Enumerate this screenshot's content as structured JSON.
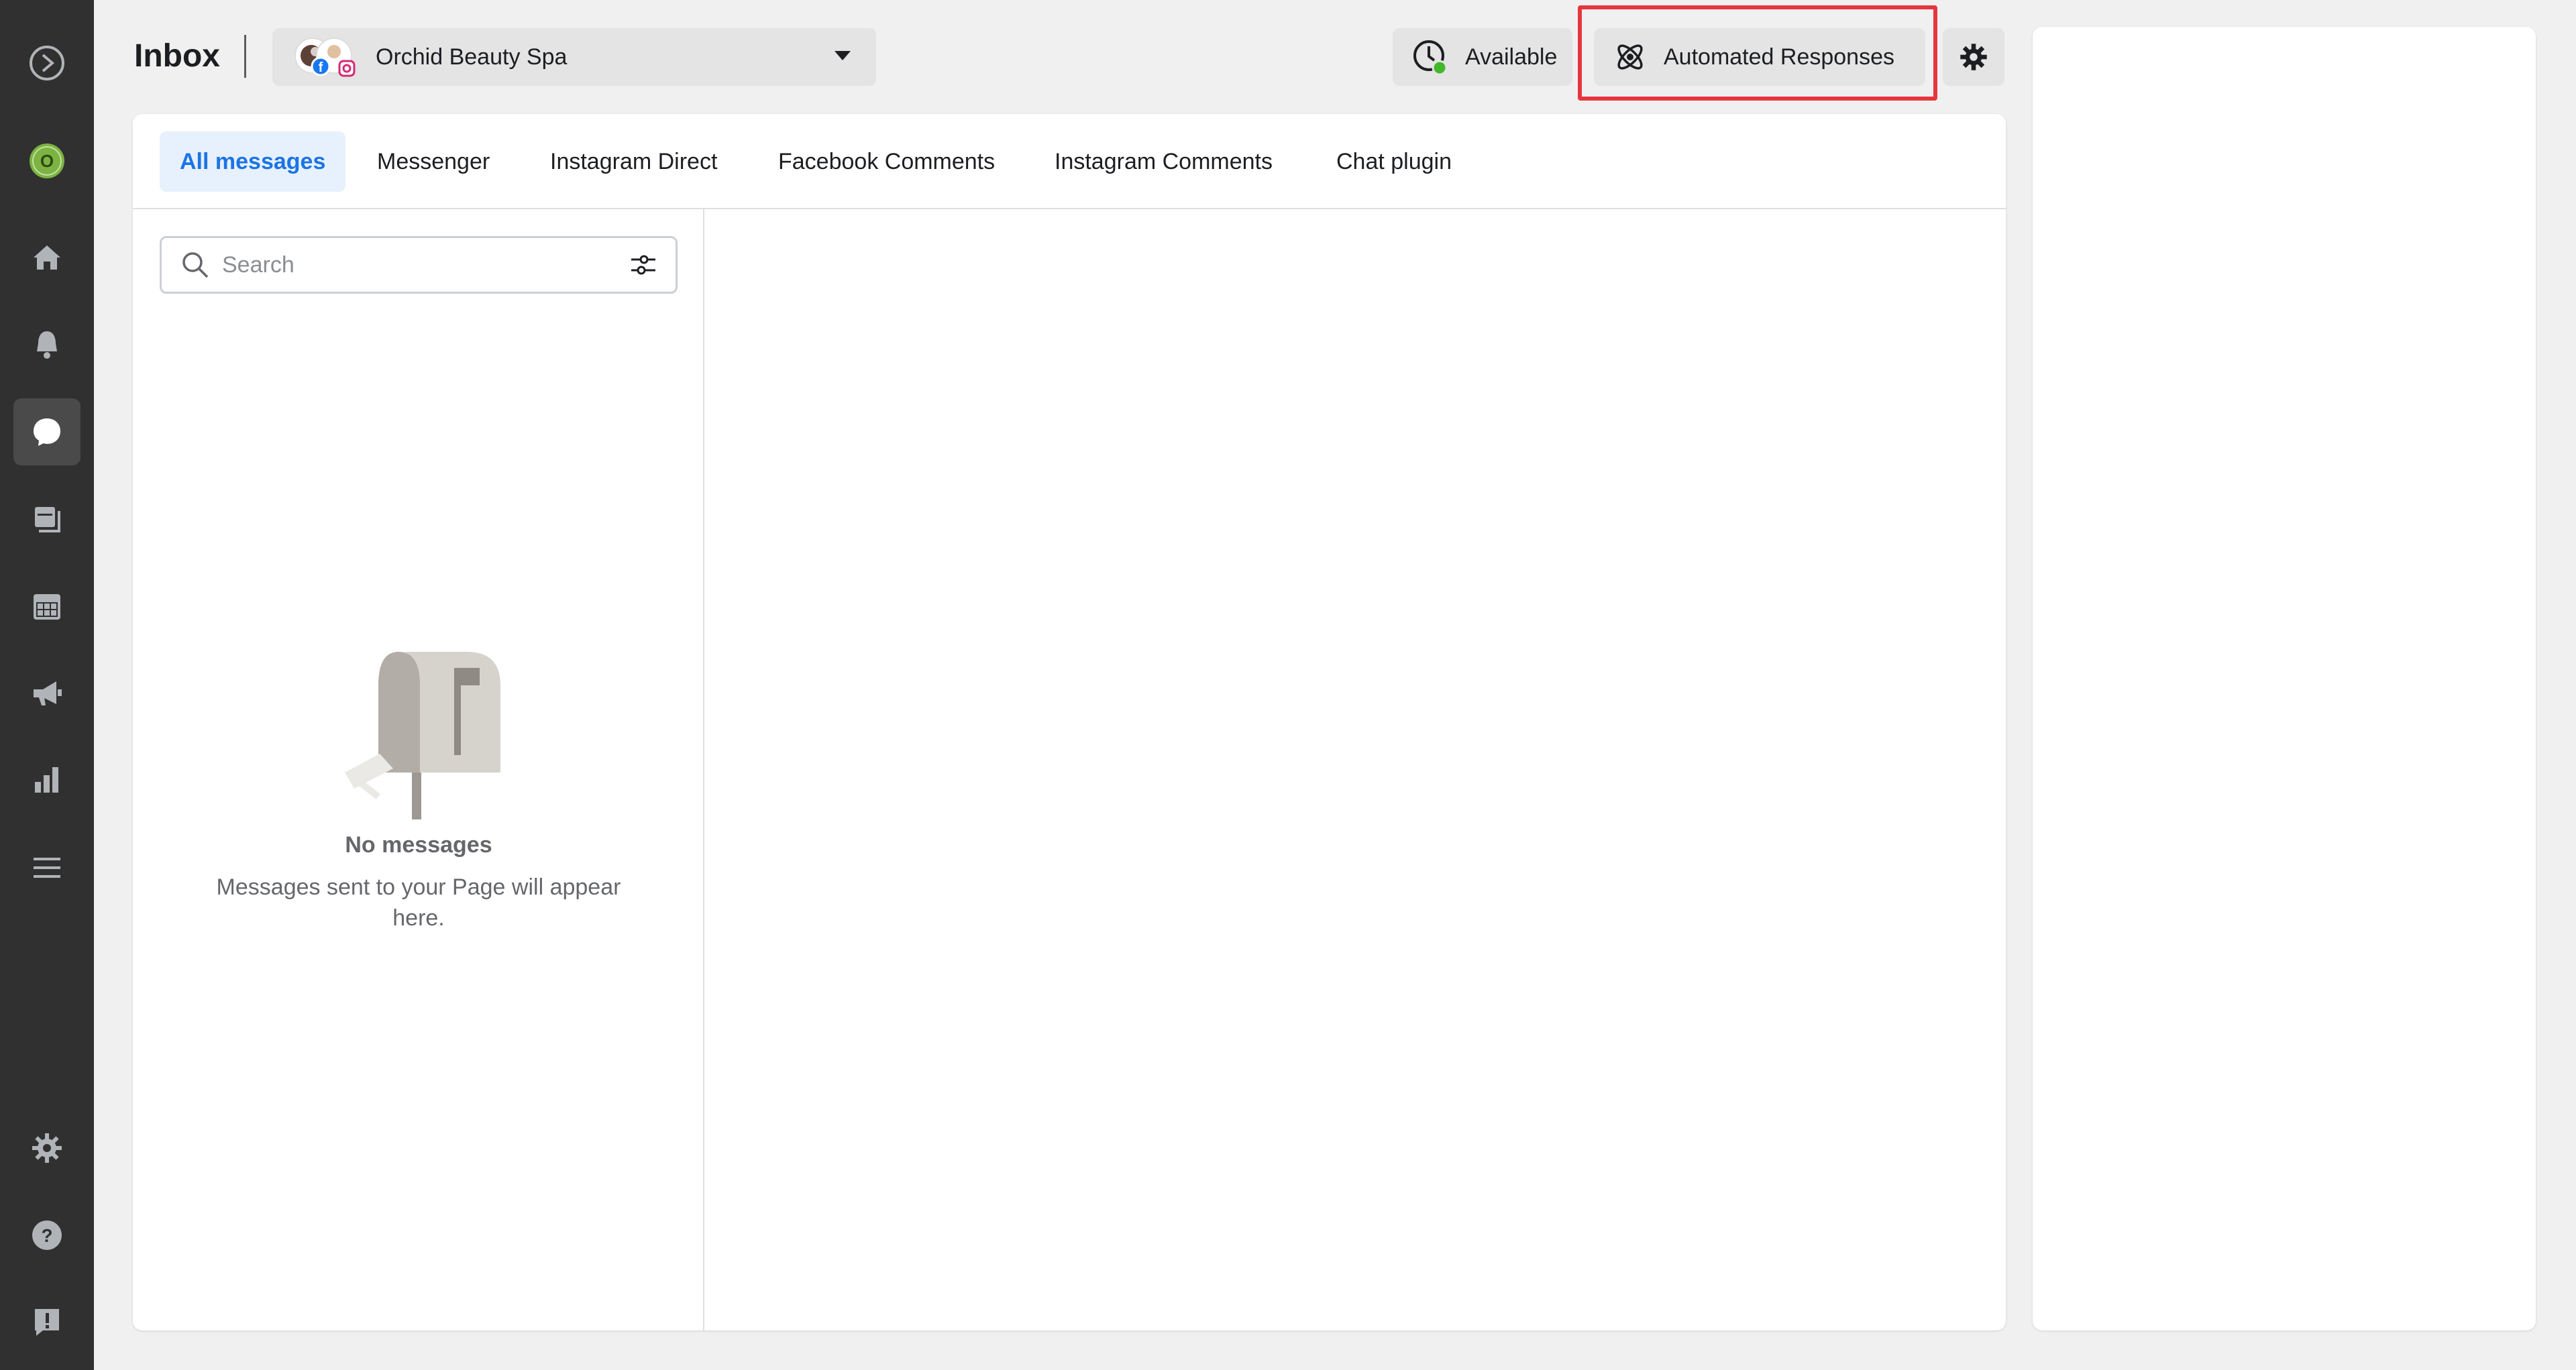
{
  "sidebar": {
    "items": [
      {
        "name": "meta-logo-icon"
      },
      {
        "name": "profile-avatar",
        "initial": "O"
      },
      {
        "name": "home-icon"
      },
      {
        "name": "notifications-icon"
      },
      {
        "name": "inbox-icon"
      },
      {
        "name": "content-icon"
      },
      {
        "name": "planner-icon"
      },
      {
        "name": "ads-icon"
      },
      {
        "name": "insights-icon"
      },
      {
        "name": "all-tools-icon"
      },
      {
        "name": "settings-icon"
      },
      {
        "name": "help-icon"
      },
      {
        "name": "report-icon"
      }
    ],
    "avatar_initial": "O"
  },
  "header": {
    "title": "Inbox",
    "page_name": "Orchid Beauty Spa",
    "availability_label": "Available",
    "automated_label": "Automated Responses"
  },
  "tabs": [
    {
      "label": "All messages",
      "active": true
    },
    {
      "label": "Messenger",
      "active": false
    },
    {
      "label": "Instagram Direct",
      "active": false
    },
    {
      "label": "Facebook Comments",
      "active": false
    },
    {
      "label": "Instagram Comments",
      "active": false
    },
    {
      "label": "Chat plugin",
      "active": false
    }
  ],
  "search": {
    "placeholder": "Search"
  },
  "empty_state": {
    "title": "No messages",
    "description": "Messages sent to your Page will appear here."
  },
  "colors": {
    "sidebar_bg": "#303030",
    "accent": "#1b74e4",
    "highlight": "#e5363d",
    "status_green": "#42b72a"
  }
}
